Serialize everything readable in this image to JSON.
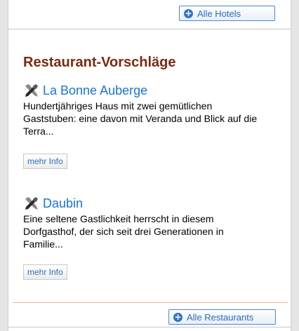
{
  "top": {
    "all_hotels_label": "Alle Hotels"
  },
  "restaurants": {
    "title": "Restaurant-Vorschläge",
    "items": [
      {
        "name": "La Bonne Auberge",
        "description": "Hundertjähriges Haus mit zwei gemütlichen Gaststuben: eine davon mit Veranda und Blick auf die Terra...",
        "more_label": "mehr Info"
      },
      {
        "name": "Daubin",
        "description": "Eine seltene Gastlichkeit herrscht in diesem Dorfgasthof, der sich seit drei Generationen in Familie...",
        "more_label": "mehr Info"
      }
    ],
    "all_restaurants_label": "Alle Restaurants"
  },
  "icons": {
    "button_icon": "plus-circle-icon",
    "item_icon": "fork-knife-icon"
  },
  "colors": {
    "title": "#7b2a10",
    "link": "#1a73d9",
    "button_border": "#4f87c9"
  }
}
